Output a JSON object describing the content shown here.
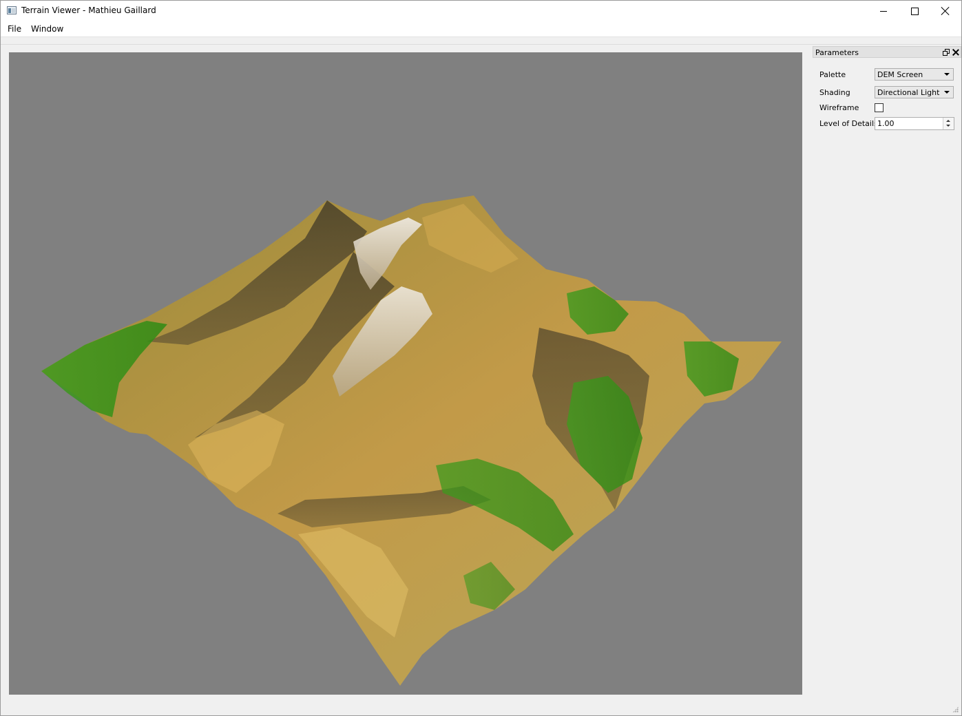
{
  "window": {
    "title": "Terrain Viewer - Mathieu Gaillard"
  },
  "menubar": {
    "items": [
      {
        "label": "File"
      },
      {
        "label": "Window"
      }
    ]
  },
  "viewport": {
    "background": "#808080",
    "content": "3d-terrain-render"
  },
  "parameters_panel": {
    "title": "Parameters",
    "palette": {
      "label": "Palette",
      "value": "DEM Screen"
    },
    "shading": {
      "label": "Shading",
      "value": "Directional Light"
    },
    "wireframe": {
      "label": "Wireframe",
      "checked": false
    },
    "level_of_details": {
      "label": "Level of Details",
      "value": "1.00"
    }
  },
  "icons": {
    "app": "app-window-icon",
    "minimize": "minimize-icon",
    "maximize": "maximize-icon",
    "close": "close-icon",
    "dock_float": "dock-float-icon",
    "dock_close": "dock-close-icon"
  }
}
